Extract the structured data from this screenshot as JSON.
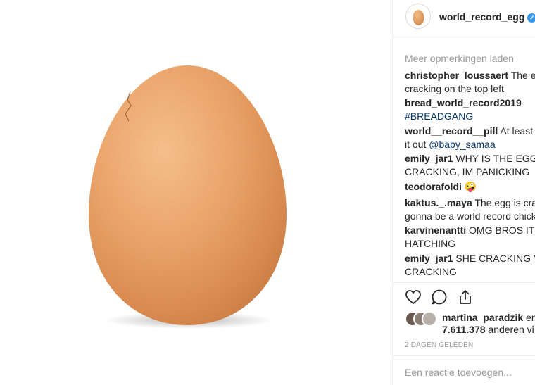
{
  "post": {
    "image_subject": "egg"
  },
  "header": {
    "username": "world_record_egg",
    "verified_mark": "✓"
  },
  "comments": {
    "load_more": "Meer opmerkingen laden",
    "items": [
      {
        "user": "christopher_loussaert",
        "text_line1": "The eg",
        "text_line2": "cracking on the top left"
      },
      {
        "user": "bread_world_record2019",
        "text_line2": "#BREADGANG"
      },
      {
        "user": "world__record__pill",
        "text_line1": "At least ju",
        "text_line2_prefix": "it out ",
        "mention": "@baby_samaa"
      },
      {
        "user": "emily_jar1",
        "text_line1": "WHY IS THE EGG",
        "text_line2": "CRACKING, IM PANICKING"
      },
      {
        "user": "teodorafoldi",
        "emoji": "🤪"
      },
      {
        "user": "kaktus._.maya",
        "text_line1": "The egg is crac",
        "text_line2": "gonna be a world record chicke"
      },
      {
        "user": "karvinenantti",
        "text_line1": "OMG BROS ITS",
        "text_line2": "HATCHING"
      },
      {
        "user": "emily_jar1",
        "text_line1": "SHE CRACKING YA",
        "text_line2": "CRACKING"
      }
    ]
  },
  "actions": {
    "like_icon": "heart-icon",
    "comment_icon": "comment-icon",
    "share_icon": "share-icon"
  },
  "likes": {
    "first_liker": "martina_paradzik",
    "connector": " en",
    "count": "7.611.378",
    "others": " anderen vi"
  },
  "timestamp": "2 DAGEN GELEDEN",
  "add_comment_placeholder": "Een reactie toevoegen..."
}
